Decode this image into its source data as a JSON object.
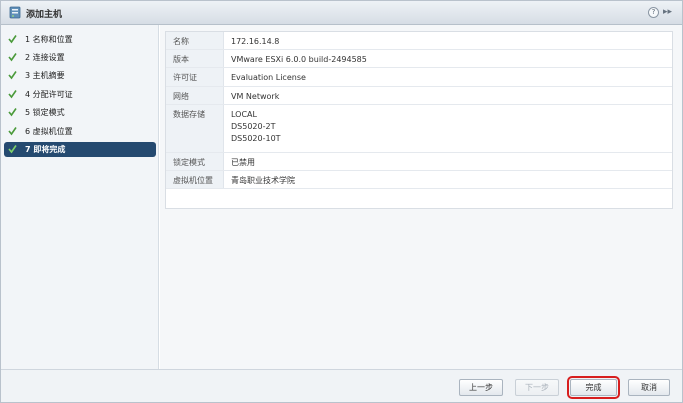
{
  "window": {
    "title": "添加主机"
  },
  "steps": [
    {
      "label": "1 名称和位置"
    },
    {
      "label": "2 连接设置"
    },
    {
      "label": "3 主机摘要"
    },
    {
      "label": "4 分配许可证"
    },
    {
      "label": "5 锁定模式"
    },
    {
      "label": "6 虚拟机位置"
    },
    {
      "label": "7 即将完成"
    }
  ],
  "summary": {
    "name_key": "名称",
    "name_val": "172.16.14.8",
    "version_key": "版本",
    "version_val": "VMware ESXi 6.0.0 build-2494585",
    "license_key": "许可证",
    "license_val": "Evaluation License",
    "network_key": "网络",
    "network_val": "VM Network",
    "datastore_key": "数据存储",
    "datastores": [
      "LOCAL",
      "DS5020-2T",
      "DS5020-10T"
    ],
    "lockdown_key": "锁定模式",
    "lockdown_val": "已禁用",
    "vmloc_key": "虚拟机位置",
    "vmloc_val": "青岛职业技术学院"
  },
  "footer": {
    "back": "上一步",
    "next": "下一步",
    "finish": "完成",
    "cancel": "取消"
  },
  "icons": {
    "help": "?",
    "expand": "▸▸"
  },
  "colors": {
    "active_step": "#254a70",
    "check": "#4a9a3a",
    "highlight": "#d71e1e"
  }
}
